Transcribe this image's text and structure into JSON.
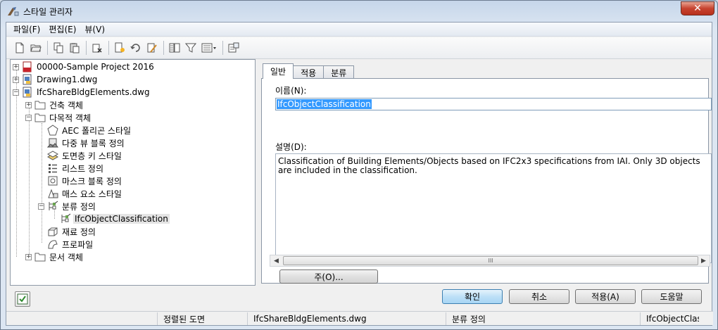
{
  "window": {
    "title": "스타일 관리자",
    "close_label": "✕"
  },
  "menu": {
    "items": [
      "파일(F)",
      "편집(E)",
      "뷰(V)"
    ]
  },
  "tree": {
    "items": [
      {
        "label": "00000-Sample Project 2016",
        "icon": "project-icon",
        "expander": "+"
      },
      {
        "label": "Drawing1.dwg",
        "icon": "dwg-file-icon",
        "expander": "+"
      },
      {
        "label": "IfcShareBldgElements.dwg",
        "icon": "dwg-file-icon",
        "expander": "−"
      },
      {
        "label": "건축 객체",
        "icon": "folder-icon",
        "expander": "+"
      },
      {
        "label": "다목적 객체",
        "icon": "folder-icon",
        "expander": "−"
      },
      {
        "label": "AEC 폴리곤 스타일",
        "icon": "polygon-style-icon"
      },
      {
        "label": "다중 뷰 블록 정의",
        "icon": "multi-view-block-icon"
      },
      {
        "label": "도면층 키 스타일",
        "icon": "layer-key-icon"
      },
      {
        "label": "리스트 정의",
        "icon": "list-definition-icon"
      },
      {
        "label": "마스크 블록 정의",
        "icon": "mask-block-icon"
      },
      {
        "label": "매스 요소 스타일",
        "icon": "mass-element-icon"
      },
      {
        "label": "분류 정의",
        "icon": "classification-icon",
        "expander": "−"
      },
      {
        "label": "IfcObjectClassification",
        "icon": "classification-icon"
      },
      {
        "label": "재료 정의",
        "icon": "material-icon"
      },
      {
        "label": "프로파일",
        "icon": "profile-icon"
      },
      {
        "label": "문서 객체",
        "icon": "folder-icon",
        "expander": "+"
      }
    ]
  },
  "tabs": [
    "일반",
    "적용",
    "분류"
  ],
  "general": {
    "name_label": "이름(N):",
    "name_value": "IfcObjectClassification",
    "desc_label": "설명(D):",
    "desc_value": "Classification of Building Elements/Objects based on IFC2x3 specifications from IAI. Only 3D objects are included in the classification.",
    "notes_button": "주(O)..."
  },
  "scrollbar": {
    "left": "◀",
    "right": "▶",
    "grip": "III"
  },
  "buttons": {
    "ok": "확인",
    "cancel": "취소",
    "apply": "적용(A)",
    "help": "도움말"
  },
  "status": {
    "view": "정렬된 도면",
    "drawing": "IfcShareBldgElements.dwg",
    "type": "분류 정의",
    "style": "IfcObjectClassification"
  },
  "colors": {
    "selection": "#3399ff",
    "ok_button": "#bde0f7",
    "close_button": "#c7432f"
  }
}
